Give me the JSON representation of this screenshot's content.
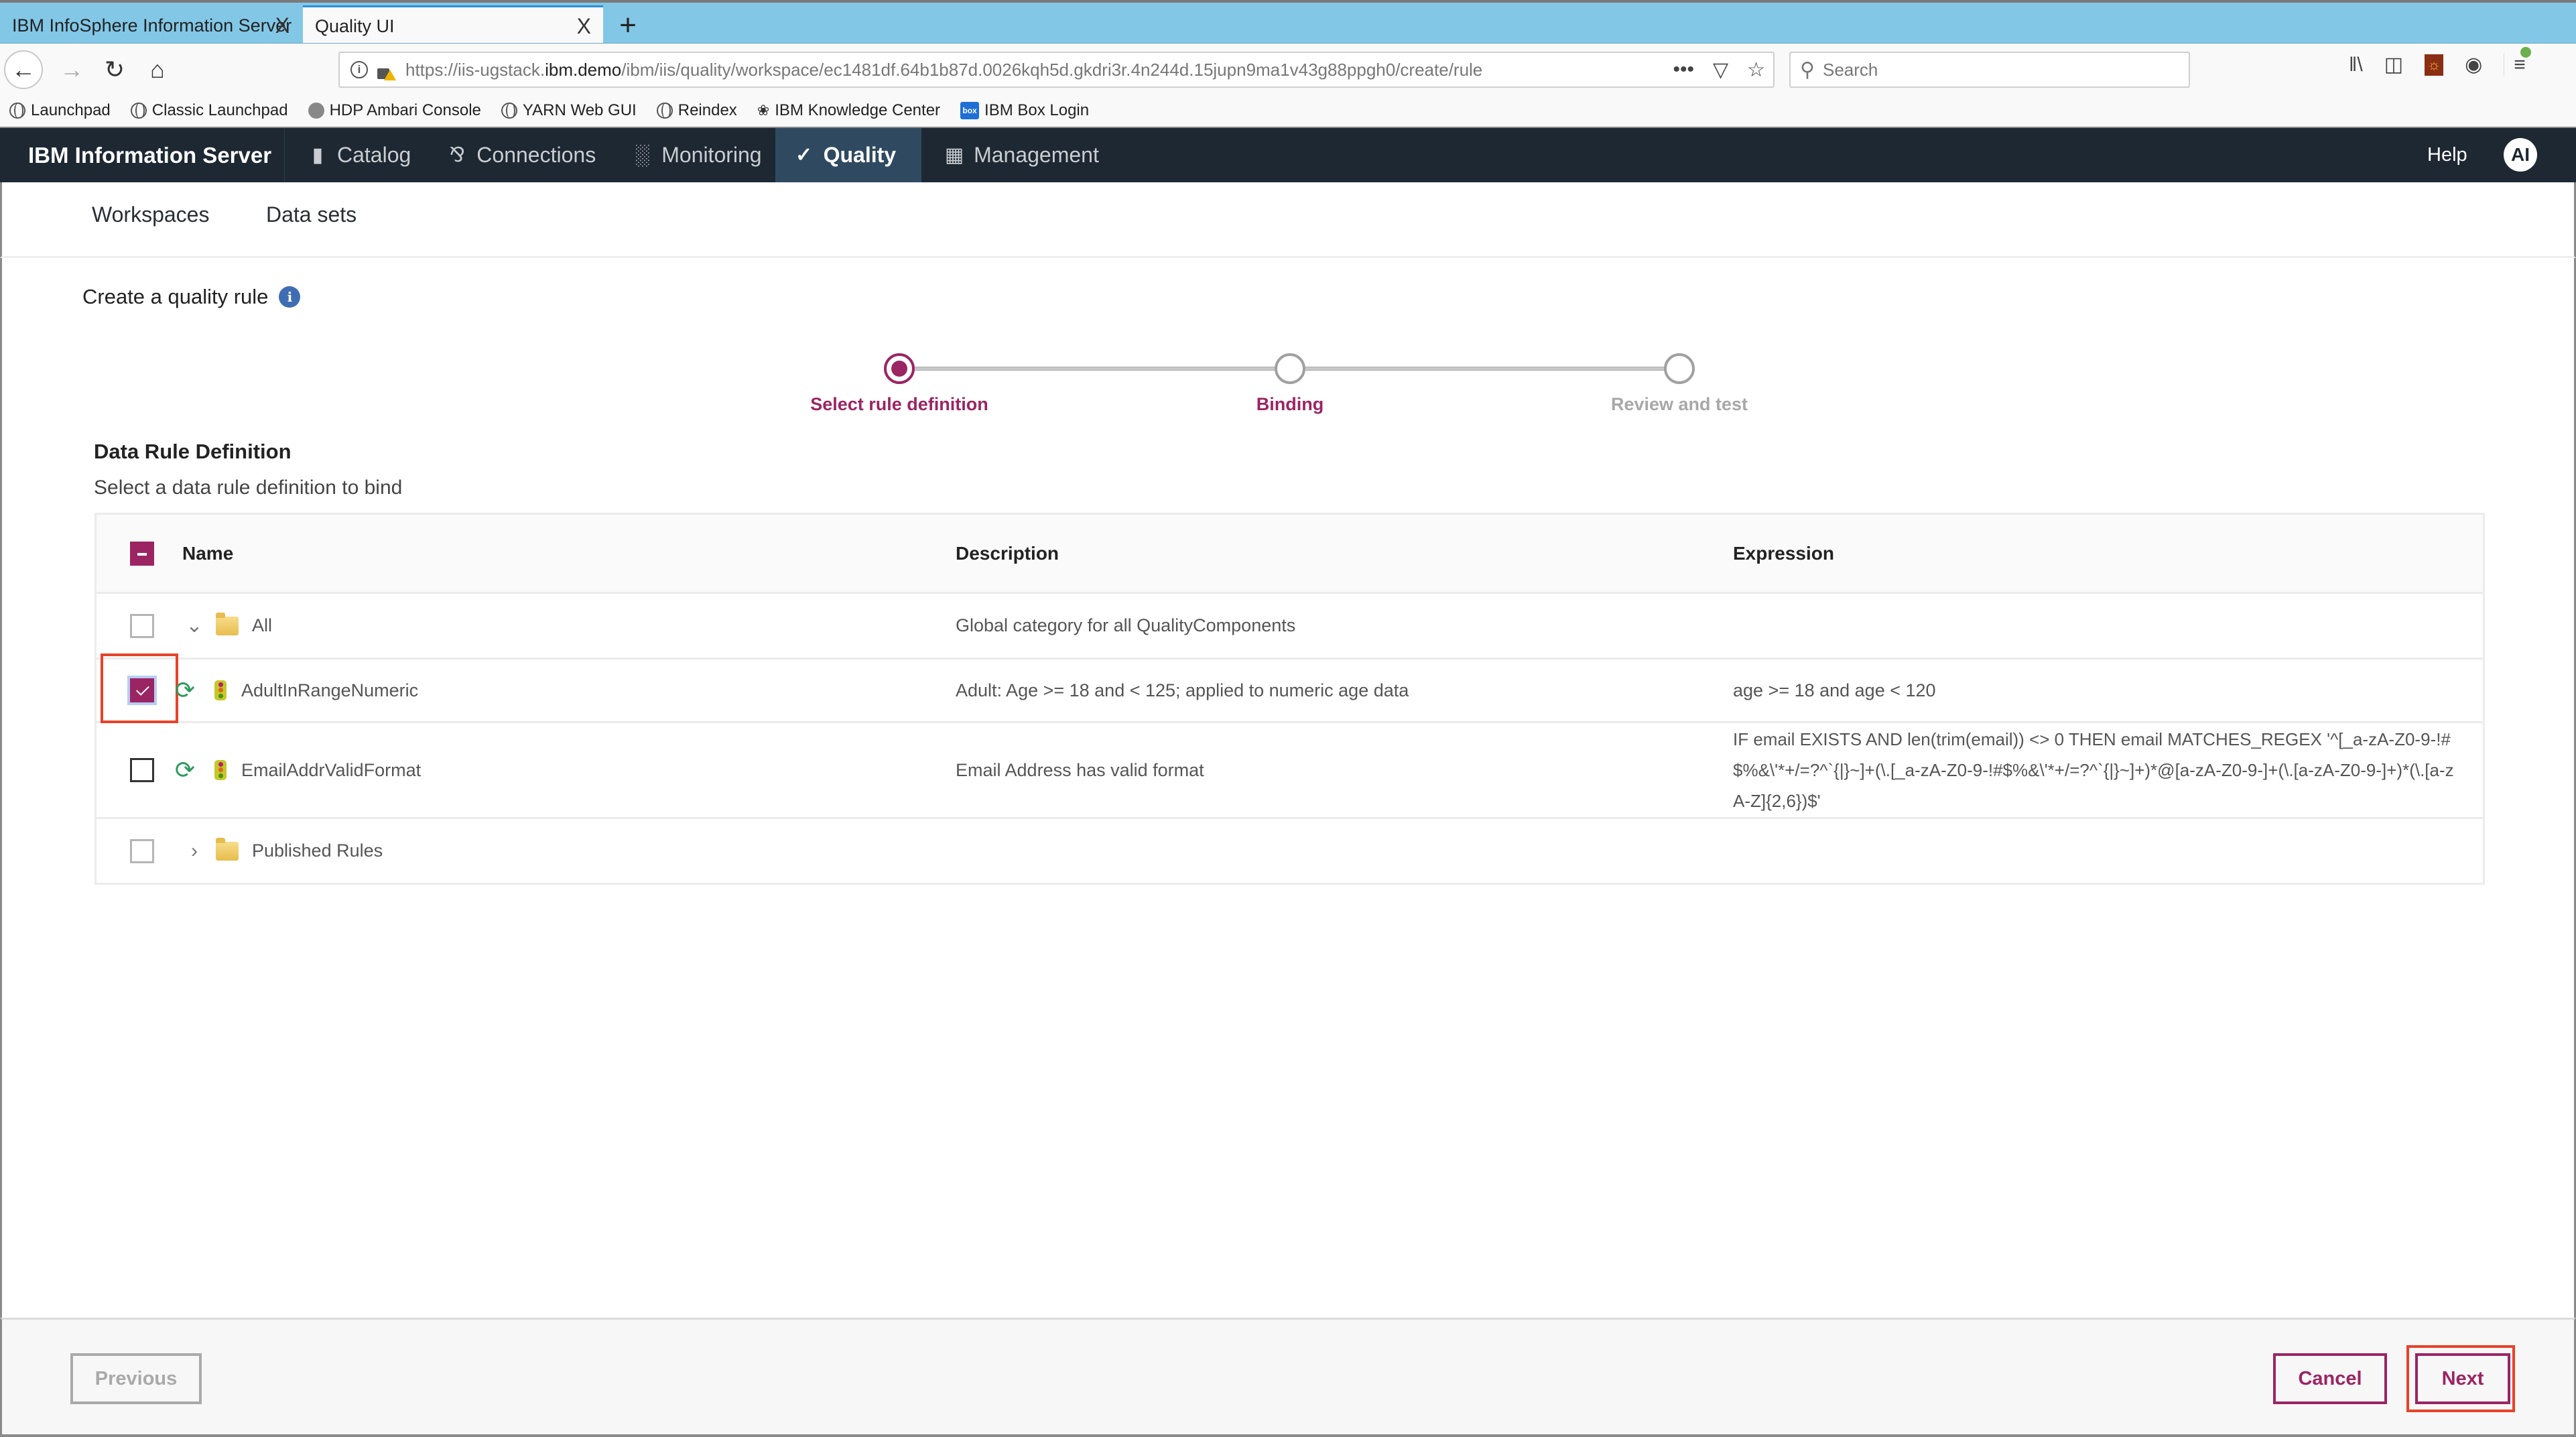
{
  "browser": {
    "tabs": [
      {
        "title": "IBM InfoSphere Information Server",
        "active": false
      },
      {
        "title": "Quality UI",
        "active": true
      }
    ],
    "tab_close_glyph": "X",
    "new_tab_glyph": "+",
    "url_prefix": "https://iis-ugstack.",
    "url_domain": "ibm.demo",
    "url_path": "/ibm/iis/quality/workspace/ec1481df.64b1b87d.0026kqh5d.gkdri3r.4n244d.15jupn9ma1v43g88ppgh0/create/rule",
    "url_more": "•••",
    "search_placeholder": "Search",
    "bookmarks": [
      {
        "label": "Launchpad",
        "icon": "globe-icon"
      },
      {
        "label": "Classic Launchpad",
        "icon": "globe-icon"
      },
      {
        "label": "HDP Ambari Console",
        "icon": "ambari-icon"
      },
      {
        "label": "YARN Web GUI",
        "icon": "globe-icon"
      },
      {
        "label": "Reindex",
        "icon": "globe-icon"
      },
      {
        "label": "IBM Knowledge Center",
        "icon": "bee-icon"
      },
      {
        "label": "IBM Box Login",
        "icon": "box-icon"
      }
    ],
    "box_icon_text": "box"
  },
  "header": {
    "brand": "IBM Information Server",
    "nav": [
      {
        "label": "Catalog",
        "icon": "catalog-icon",
        "active": false
      },
      {
        "label": "Connections",
        "icon": "connections-icon",
        "active": false
      },
      {
        "label": "Monitoring",
        "icon": "monitoring-icon",
        "active": false
      },
      {
        "label": "Quality",
        "icon": "check-circle-icon",
        "active": true
      },
      {
        "label": "Management",
        "icon": "calendar-icon",
        "active": false
      }
    ],
    "help": "Help",
    "avatar_initials": "AI"
  },
  "subnav": {
    "items": [
      "Workspaces",
      "Data sets"
    ]
  },
  "page": {
    "title": "Create a quality rule",
    "info_glyph": "i"
  },
  "stepper": {
    "steps": [
      {
        "label": "Select rule definition",
        "state": "current"
      },
      {
        "label": "Binding",
        "state": "next"
      },
      {
        "label": "Review and test",
        "state": "future"
      }
    ]
  },
  "section": {
    "title": "Data Rule Definition",
    "subtitle": "Select a data rule definition to bind"
  },
  "table": {
    "columns": [
      "Name",
      "Description",
      "Expression"
    ],
    "header_checkbox_state": "indeterminate",
    "rows": [
      {
        "type": "folder",
        "expanded": true,
        "checked": false,
        "name": "All",
        "description": "Global category for all QualityComponents",
        "expression": ""
      },
      {
        "type": "rule",
        "checked": true,
        "name": "AdultInRangeNumeric",
        "description": "Adult: Age >= 18 and < 125; applied to numeric age data",
        "expression": "age >= 18 and age < 120"
      },
      {
        "type": "rule",
        "checked": false,
        "name": "EmailAddrValidFormat",
        "description": "Email Address has valid format",
        "expression": "IF email EXISTS AND len(trim(email)) <> 0 THEN email MATCHES_REGEX '^[_a-zA-Z0-9-!#$%&\\'*+/=?^`{|}~]+(\\.[_a-zA-Z0-9-!#$%&\\'*+/=?^`{|}~]+)*@[a-zA-Z0-9-]+(\\.[a-zA-Z0-9-]+)*(\\.[a-zA-Z]{2,6})$'"
      },
      {
        "type": "folder",
        "expanded": false,
        "checked": false,
        "name": "Published Rules",
        "description": "",
        "expression": ""
      }
    ]
  },
  "footer": {
    "previous": "Previous",
    "cancel": "Cancel",
    "next": "Next"
  },
  "colors": {
    "accent": "#9b2563",
    "header_bg": "#1d2833",
    "header_active": "#2f4a60",
    "highlight": "#e8422a",
    "tabbar": "#82c7e6",
    "info": "#3f6db3",
    "sync": "#2e9a5e"
  }
}
